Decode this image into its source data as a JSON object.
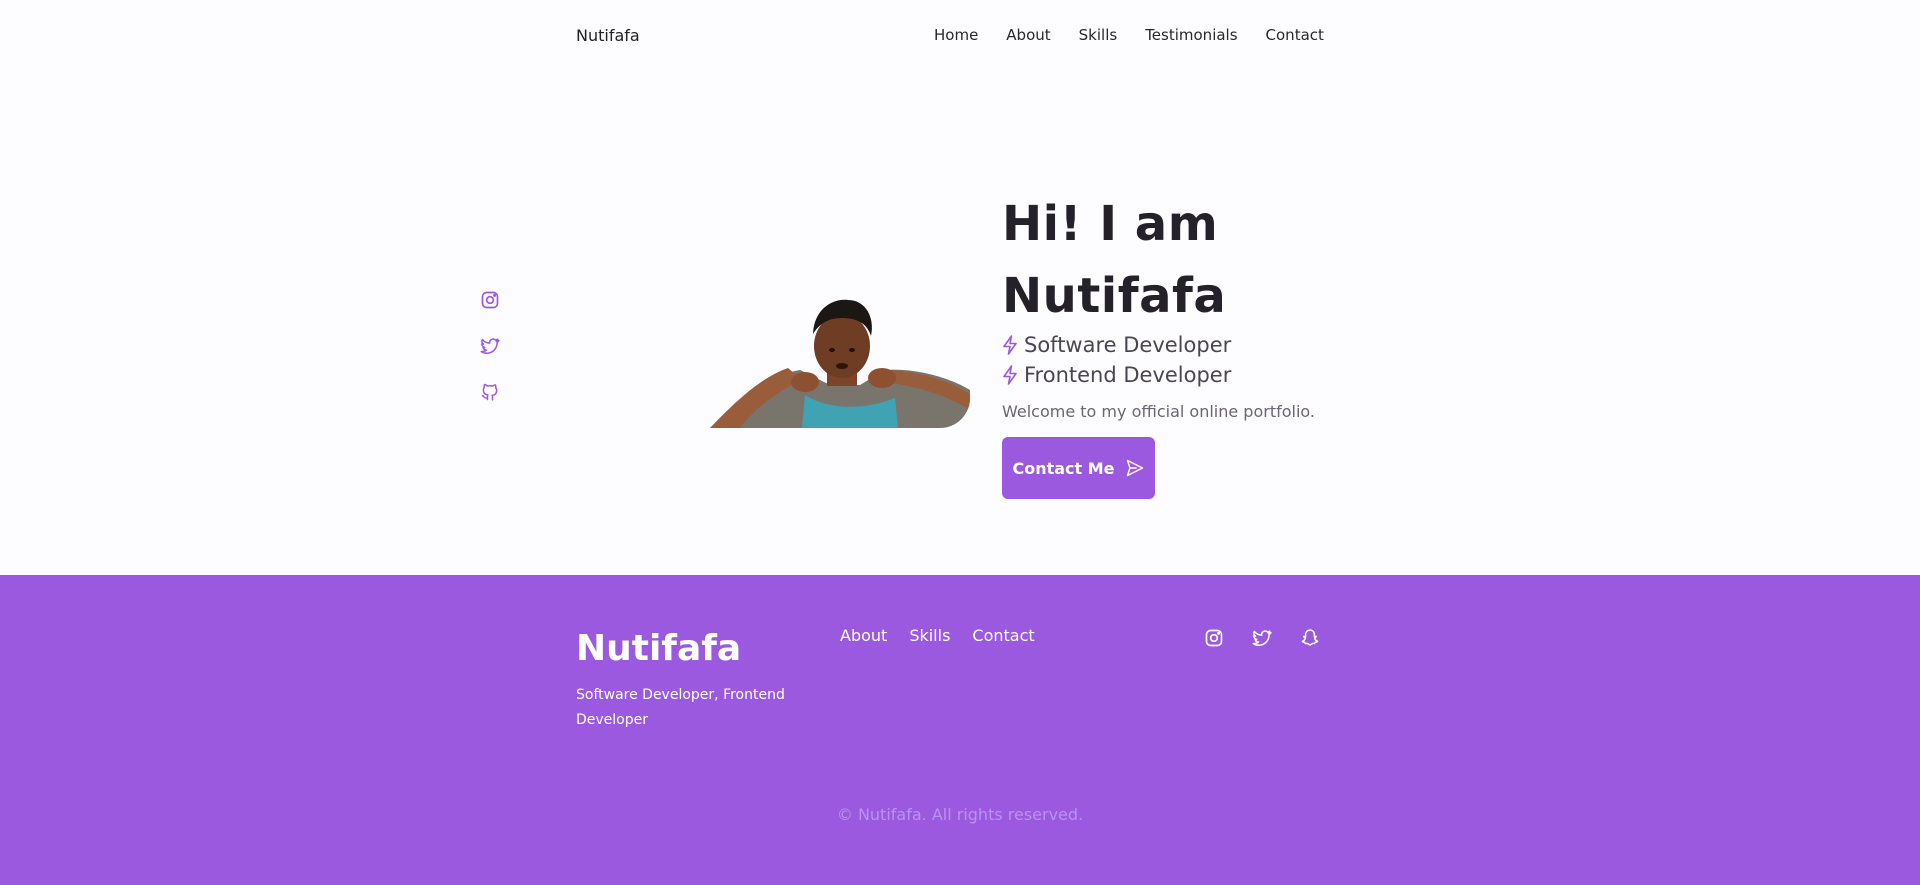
{
  "header": {
    "logo": "Nutifafa",
    "nav": [
      "Home",
      "About",
      "Skills",
      "Testimonials",
      "Contact"
    ]
  },
  "sidebar_social": [
    "instagram-icon",
    "twitter-icon",
    "github-icon"
  ],
  "hero": {
    "title_line1": "Hi! I am",
    "title_line2": "Nutifafa",
    "roles": [
      "Software Developer",
      "Frontend Developer"
    ],
    "welcome": "Welcome to my official online portfolio.",
    "cta_label": "Contact Me"
  },
  "footer": {
    "brand": "Nutifafa",
    "tagline": "Software Developer, Frontend Developer",
    "links": [
      "About",
      "Skills",
      "Contact"
    ],
    "social": [
      "instagram-icon",
      "twitter-icon",
      "snapchat-icon"
    ],
    "copyright": "© Nutifafa. All rights reserved."
  },
  "colors": {
    "accent": "#9b59e0",
    "background": "#fdfcfe",
    "heading": "#24212a",
    "text_muted": "#6b6574"
  }
}
